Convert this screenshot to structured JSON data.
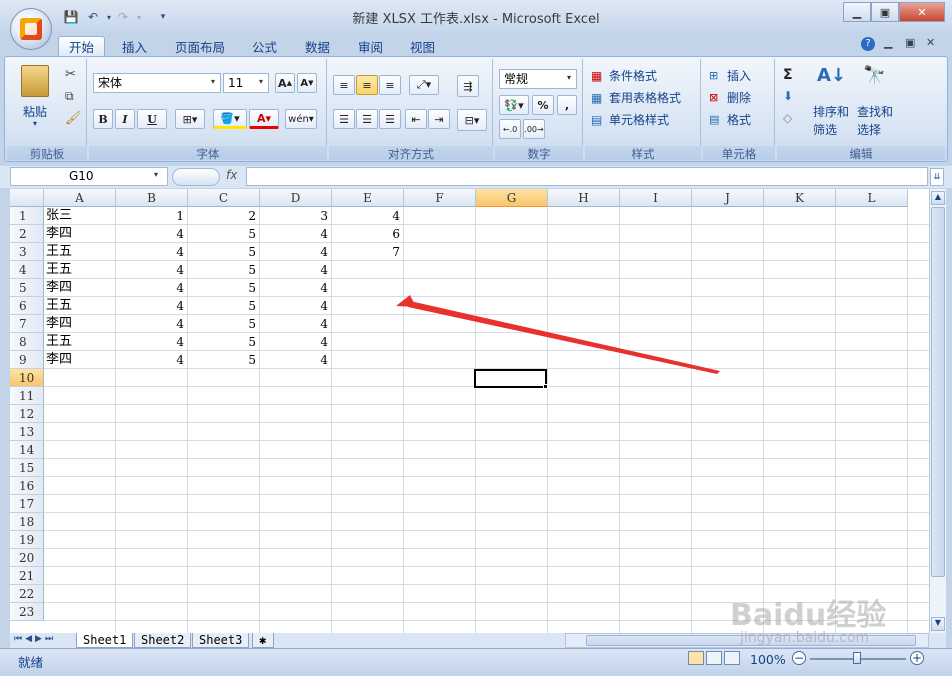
{
  "window": {
    "title": "新建 XLSX 工作表.xlsx - Microsoft Excel"
  },
  "tabs": [
    "开始",
    "插入",
    "页面布局",
    "公式",
    "数据",
    "审阅",
    "视图"
  ],
  "ribbon": {
    "clipboard": {
      "paste": "粘贴",
      "label": "剪贴板"
    },
    "font": {
      "name": "宋体",
      "size": "11",
      "label": "字体",
      "bold": "B",
      "italic": "I",
      "underline": "U"
    },
    "alignment": {
      "label": "对齐方式"
    },
    "number": {
      "format": "常规",
      "label": "数字",
      "percent": "%",
      "comma": ","
    },
    "styles": {
      "conditional": "条件格式",
      "table": "套用表格格式",
      "cell": "单元格样式",
      "label": "样式"
    },
    "cells": {
      "insert": "插入",
      "delete": "删除",
      "format": "格式",
      "label": "单元格"
    },
    "editing": {
      "sort": "排序和",
      "sort2": "筛选",
      "find": "查找和",
      "find2": "选择",
      "label": "编辑",
      "sigma": "Σ"
    }
  },
  "formula_bar": {
    "name_box": "G10",
    "fx": "fx",
    "value": ""
  },
  "columns": [
    "A",
    "B",
    "C",
    "D",
    "E",
    "F",
    "G",
    "H",
    "I",
    "J",
    "K",
    "L"
  ],
  "rows": [
    "1",
    "2",
    "3",
    "4",
    "5",
    "6",
    "7",
    "8",
    "9",
    "10",
    "11",
    "12",
    "13",
    "14",
    "15",
    "16",
    "17",
    "18",
    "19",
    "20",
    "21",
    "22",
    "23"
  ],
  "cells": [
    [
      "张三",
      "1",
      "2",
      "3",
      "4"
    ],
    [
      "李四",
      "4",
      "5",
      "4",
      "6"
    ],
    [
      "王五",
      "4",
      "5",
      "4",
      "7"
    ],
    [
      "王五",
      "4",
      "5",
      "4",
      ""
    ],
    [
      "李四",
      "4",
      "5",
      "4",
      ""
    ],
    [
      "王五",
      "4",
      "5",
      "4",
      ""
    ],
    [
      "李四",
      "4",
      "5",
      "4",
      ""
    ],
    [
      "王五",
      "4",
      "5",
      "4",
      ""
    ],
    [
      "李四",
      "4",
      "5",
      "4",
      ""
    ]
  ],
  "sheets": [
    "Sheet1",
    "Sheet2",
    "Sheet3"
  ],
  "status": {
    "text": "就绪",
    "zoom": "100%"
  },
  "watermark": {
    "text": "Baidu经验",
    "url": "jingyan.baidu.com"
  },
  "colors": {
    "accent": "#15428b",
    "selected_header": "#f9c56b",
    "arrow": "#e8302c"
  }
}
